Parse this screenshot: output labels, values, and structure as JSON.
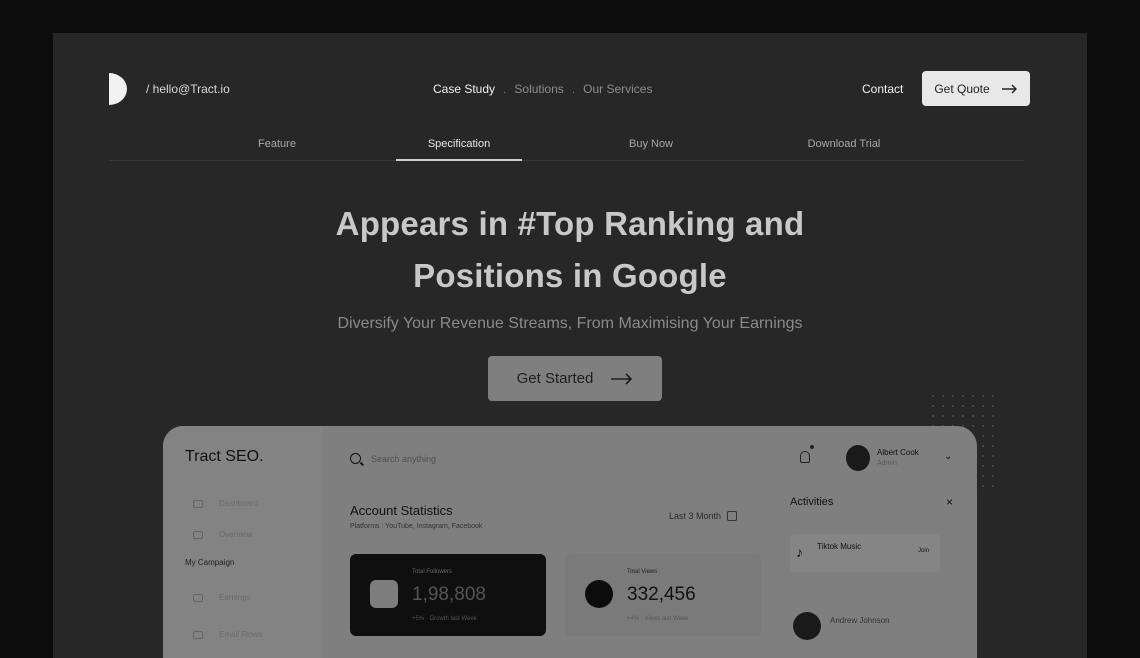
{
  "header": {
    "email": "/ hello@Tract.io",
    "nav": [
      "Case Study",
      "Solutions",
      "Our Services"
    ],
    "nav_sep": ".",
    "contact": "Contact",
    "quote": "Get Quote"
  },
  "subnav": {
    "items": [
      "Feature",
      "Specification",
      "Buy Now",
      "Download Trial"
    ]
  },
  "hero": {
    "title_line1": "Appears in #Top Ranking and",
    "title_line2": "Positions in Google",
    "subtitle": "Diversify Your Revenue Streams, From Maximising Your Earnings",
    "cta": "Get Started"
  },
  "dashboard": {
    "brand": "Tract SEO.",
    "sidebar": {
      "items": [
        "Dashboard",
        "Overview"
      ],
      "section": "My Campaign",
      "items2": [
        "Earnings",
        "Email Flows"
      ]
    },
    "search_placeholder": "Search anything",
    "user": {
      "name": "Albert Cook",
      "role": "Admin"
    },
    "account": {
      "title": "Account Statistics",
      "subtitle": "Platforms : YouTube, Instagram, Facebook",
      "range": "Last 3 Month"
    },
    "cards": [
      {
        "label": "Total Followers",
        "value": "1,98,808",
        "foot": "+5% · Growth last Week"
      },
      {
        "label": "Total Views",
        "value": "332,456",
        "foot": "+4% · Views last Week"
      }
    ],
    "activities": {
      "title": "Activities",
      "close": "×",
      "items": [
        {
          "name": "Tiktok Music",
          "tag": "Join"
        },
        {
          "name": "Andrew Johnson"
        }
      ]
    }
  }
}
